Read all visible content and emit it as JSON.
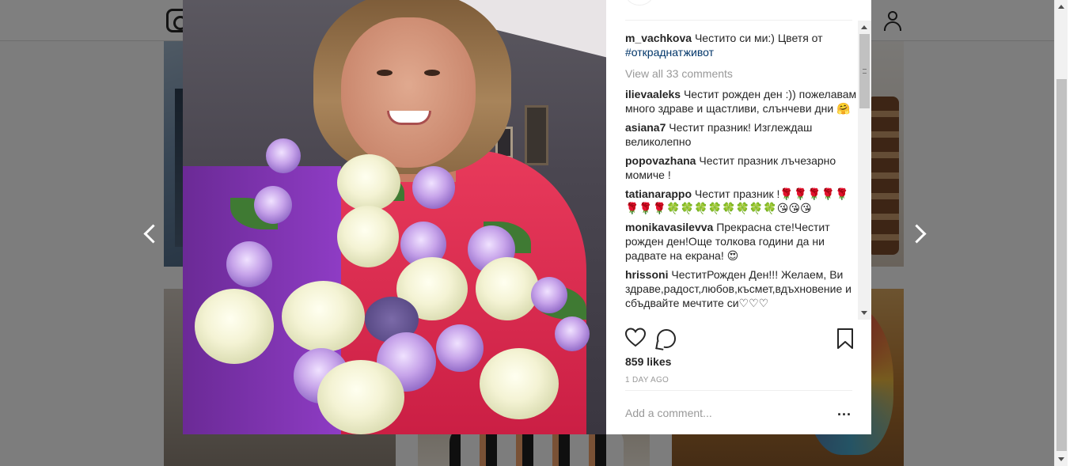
{
  "background": {
    "header": {
      "logo_icon": "instagram-camera-icon",
      "profile_icon": "person-icon"
    }
  },
  "navigation": {
    "prev_icon": "chevron-left-icon",
    "next_icon": "chevron-right-icon"
  },
  "post": {
    "photo_alt": "Woman smiling holding a bouquet of white roses and purple lisianthus",
    "caption": {
      "username": "m_vachkova",
      "text": "Честито си ми:) Цветя от",
      "hashtag": "#откраднатживот"
    },
    "view_all_comments": "View all 33 comments",
    "comments": [
      {
        "username": "ilievaaleks",
        "text": "Честит рожден ден :)) пожелавам много здраве и щастливи, слънчеви дни 🤗"
      },
      {
        "username": "asiana7",
        "text": "Честит празник! Изглеждаш великолепно"
      },
      {
        "username": "popovazhana",
        "text": "Честит празник лъчезарно момиче !"
      },
      {
        "username": "tatianarappo",
        "text": "Честит празник !🌹🌹🌹🌹🌹🌹🌹🌹🍀🍀🍀🍀🍀🍀🍀🍀😘😘😘"
      },
      {
        "username": "monikavasilevva",
        "text": "Прекрасна сте!Честит рожден ден!Още толкова години да ни радвате на екрана! 😍"
      },
      {
        "username": "hrissoni",
        "text": "ЧеститРожден Ден!!! Желаем, Ви здраве,радост,любов,късмет,вдъхновение и сбъдвайте мечтите си♡♡♡"
      }
    ],
    "actions": {
      "like_icon": "heart-icon",
      "comment_icon": "comment-bubble-icon",
      "save_icon": "bookmark-icon"
    },
    "likes": "859 likes",
    "timestamp": "1 DAY AGO",
    "add_comment_placeholder": "Add a comment...",
    "more_options": "..."
  },
  "colors": {
    "username": "#262626",
    "hashtag": "#003569",
    "muted": "#999999",
    "overlay": "rgba(0,0,0,0.5)"
  }
}
